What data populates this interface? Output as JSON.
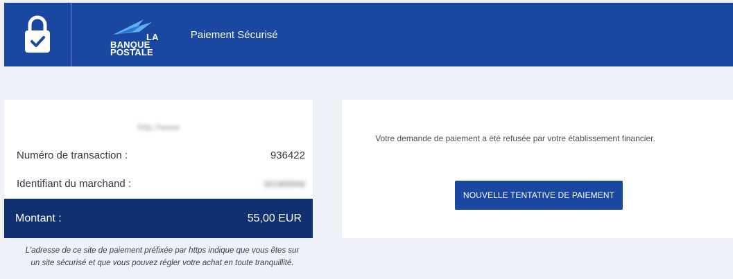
{
  "header": {
    "brand_lines": [
      "LA",
      "BANQUE",
      "POSTALE"
    ],
    "title": "Paiement Sécurisé",
    "colors": {
      "header_bg": "#1a47a0",
      "amount_bg": "#10306f",
      "page_bg": "#eef2f8"
    },
    "icons": [
      "lock-check-icon",
      "bird-logo-icon"
    ]
  },
  "summary": {
    "merchant_name": "http://www",
    "transaction_label": "Numéro de transaction :",
    "transaction_value": "936422",
    "merchant_id_label": "Identifiant du marchand :",
    "merchant_id_value": "301969948",
    "amount_label": "Montant :",
    "amount_value": "55,00 EUR"
  },
  "security_note": {
    "line1": "L'adresse de ce site de paiement préfixée par https indique que vous êtes sur",
    "line2": "un site sécurisé et que vous pouvez régler votre achat en toute tranquillité."
  },
  "result": {
    "message": "Votre demande de paiement a été refusée par votre établissement financier.",
    "retry_label": "NOUVELLE TENTATIVE DE PAIEMENT"
  }
}
